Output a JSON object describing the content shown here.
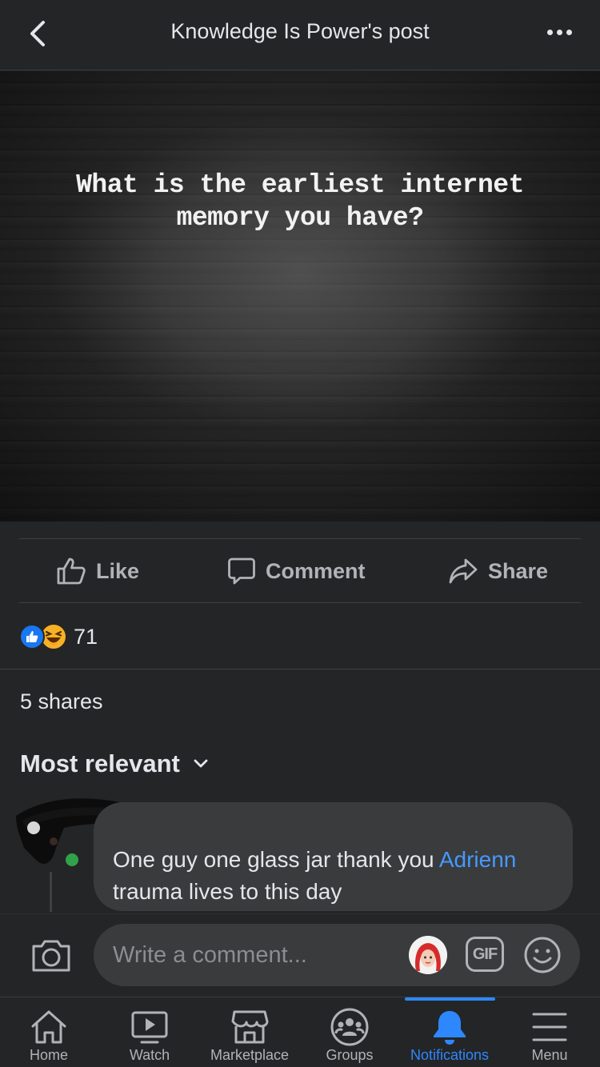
{
  "header": {
    "title": "Knowledge Is Power's post"
  },
  "post": {
    "image_text": "What is the earliest internet memory you have?"
  },
  "actions": {
    "like": "Like",
    "comment": "Comment",
    "share": "Share"
  },
  "reactions": {
    "count": "71",
    "types": [
      "like",
      "haha"
    ]
  },
  "shares": "5 shares",
  "comments": {
    "sort_label": "Most relevant",
    "items": [
      {
        "text_before": "One guy one glass jar thank you ",
        "mention": "Adrienn",
        "text_after": " trauma lives to this day",
        "online": true
      }
    ]
  },
  "composer": {
    "placeholder": "Write a comment...",
    "gif_label": "GIF"
  },
  "tabbar": {
    "tabs": [
      {
        "label": "Home",
        "icon": "home-icon",
        "active": false
      },
      {
        "label": "Watch",
        "icon": "watch-icon",
        "active": false
      },
      {
        "label": "Marketplace",
        "icon": "marketplace-icon",
        "active": false
      },
      {
        "label": "Groups",
        "icon": "groups-icon",
        "active": false
      },
      {
        "label": "Notifications",
        "icon": "bell-icon",
        "active": true
      },
      {
        "label": "Menu",
        "icon": "hamburger-icon",
        "active": false
      }
    ]
  },
  "colors": {
    "background": "#242526",
    "surface": "#3a3b3c",
    "accent": "#2d88ff",
    "mention": "#4599ff",
    "online": "#31a24c"
  }
}
